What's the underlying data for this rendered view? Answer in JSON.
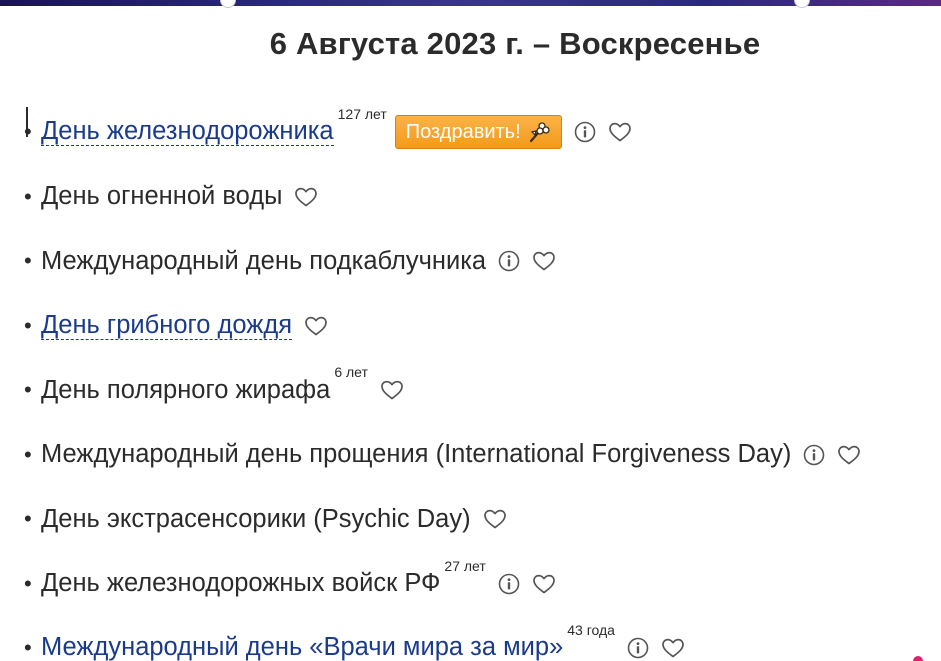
{
  "header": {
    "title": "6 Августа 2023 г. – Воскресенье"
  },
  "holidays": [
    {
      "bullet": "•",
      "name": "День железнодорожника",
      "link": true,
      "sup": "127 лет",
      "congrats": "Поздравить!",
      "info": true
    },
    {
      "bullet": "•",
      "name": "День огненной воды",
      "link": false,
      "sup": "",
      "congrats": "",
      "info": false
    },
    {
      "bullet": "•",
      "name": "Международный день подкаблучника",
      "link": false,
      "sup": "",
      "congrats": "",
      "info": true
    },
    {
      "bullet": "•",
      "name": "День грибного дождя",
      "link": true,
      "sup": "",
      "congrats": "",
      "info": false
    },
    {
      "bullet": "•",
      "name": "День полярного жирафа",
      "link": false,
      "sup": "6 лет",
      "congrats": "",
      "info": false
    },
    {
      "bullet": "•",
      "name": "Международный день прощения (International Forgiveness Day)",
      "link": false,
      "sup": "",
      "congrats": "",
      "info": true
    },
    {
      "bullet": "•",
      "name": "День экстрасенсорики (Psychic Day)",
      "link": false,
      "sup": "",
      "congrats": "",
      "info": false
    },
    {
      "bullet": "•",
      "name": "День железнодорожных войск РФ",
      "link": false,
      "sup": "27 лет",
      "congrats": "",
      "info": true
    },
    {
      "bullet": "•",
      "name": "Международный день «Врачи мира за мир»",
      "link": true,
      "sup": "43 года",
      "congrats": "",
      "info": true
    }
  ],
  "icons": {
    "info": "info-icon",
    "heart": "heart-outline-icon",
    "bouquet": "bouquet-icon"
  },
  "colors": {
    "text": "#2b2b2b",
    "link": "#1a3a8c",
    "button": "#f39a1a",
    "icon": "#555555"
  }
}
